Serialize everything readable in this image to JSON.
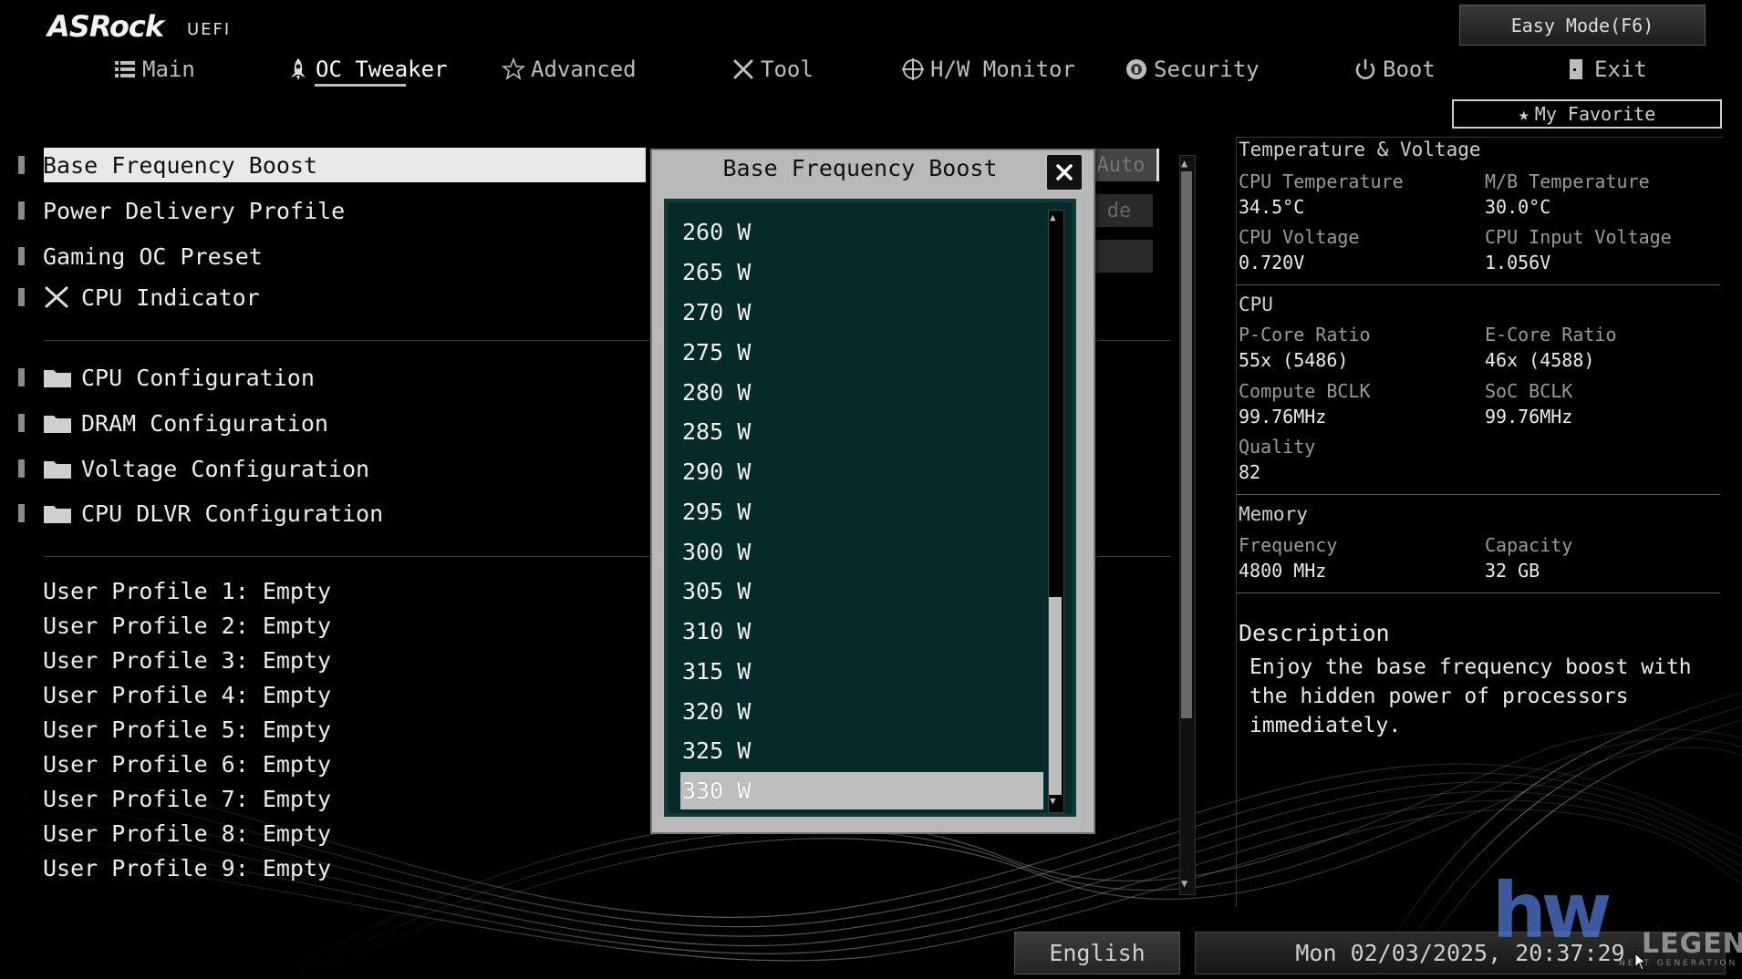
{
  "header": {
    "brand": "ASRock",
    "brand_sub": "UEFI",
    "easy_mode_label": "Easy Mode(F6)",
    "my_favorite_label": "My Favorite",
    "tabs": [
      {
        "label": "Main",
        "icon": "list-icon"
      },
      {
        "label": "OC Tweaker",
        "icon": "rocket-icon",
        "active": true
      },
      {
        "label": "Advanced",
        "icon": "star-icon"
      },
      {
        "label": "Tool",
        "icon": "tools-icon"
      },
      {
        "label": "H/W Monitor",
        "icon": "target-icon"
      },
      {
        "label": "Security",
        "icon": "shield-icon"
      },
      {
        "label": "Boot",
        "icon": "power-icon"
      },
      {
        "label": "Exit",
        "icon": "exit-icon"
      }
    ]
  },
  "menu": {
    "items": [
      {
        "label": "Base Frequency Boost",
        "selected": true
      },
      {
        "label": "Power Delivery Profile"
      },
      {
        "label": "Gaming OC Preset"
      },
      {
        "label": "CPU Indicator",
        "icon": "tools-icon"
      }
    ],
    "submenus": [
      {
        "label": "CPU Configuration",
        "icon": "folder-icon"
      },
      {
        "label": "DRAM Configuration",
        "icon": "folder-icon"
      },
      {
        "label": "Voltage Configuration",
        "icon": "folder-icon"
      },
      {
        "label": "CPU DLVR Configuration",
        "icon": "folder-icon"
      }
    ],
    "profiles": [
      "User Profile 1: Empty",
      "User Profile 2: Empty",
      "User Profile 3: Empty",
      "User Profile 4: Empty",
      "User Profile 5: Empty",
      "User Profile 6: Empty",
      "User Profile 7: Empty",
      "User Profile 8: Empty",
      "User Profile 9: Empty"
    ],
    "hidden_values": [
      "Auto",
      "de"
    ]
  },
  "modal": {
    "title": "Base Frequency Boost",
    "options": [
      "260 W",
      "265 W",
      "270 W",
      "275 W",
      "280 W",
      "285 W",
      "290 W",
      "295 W",
      "300 W",
      "305 W",
      "310 W",
      "315 W",
      "320 W",
      "325 W",
      "330 W"
    ],
    "selected": "330 W"
  },
  "right_panel": {
    "temp_voltage": {
      "heading": "Temperature & Voltage",
      "cpu_temp_label": "CPU Temperature",
      "cpu_temp": "34.5°C",
      "mb_temp_label": "M/B Temperature",
      "mb_temp": "30.0°C",
      "cpu_voltage_label": "CPU Voltage",
      "cpu_voltage": "0.720V",
      "cpu_input_voltage_label": "CPU Input Voltage",
      "cpu_input_voltage": "1.056V"
    },
    "cpu": {
      "heading": "CPU",
      "pcore_label": "P-Core Ratio",
      "pcore": "55x (5486)",
      "ecore_label": "E-Core Ratio",
      "ecore": "46x (4588)",
      "compute_bclk_label": "Compute BCLK",
      "compute_bclk": "99.76MHz",
      "soc_bclk_label": "SoC BCLK",
      "soc_bclk": "99.76MHz",
      "quality_label": "Quality",
      "quality": "82"
    },
    "memory": {
      "heading": "Memory",
      "frequency_label": "Frequency",
      "frequency": "4800 MHz",
      "capacity_label": "Capacity",
      "capacity": "32 GB"
    },
    "description": {
      "heading": "Description",
      "lines": [
        "Enjoy the base frequency boost with",
        "the hidden power of processors",
        "immediately."
      ]
    }
  },
  "footer": {
    "language": "English",
    "datetime": "Mon 02/03/2025, 20:37:29"
  },
  "watermark": {
    "logo": "hw",
    "name": "LEGEND",
    "tagline": "NEXT GENERATION"
  },
  "colors": {
    "background": "#000000",
    "list_background": "#062a29",
    "selected_row": "#bfbfbf",
    "text": "#e6e6e6"
  }
}
